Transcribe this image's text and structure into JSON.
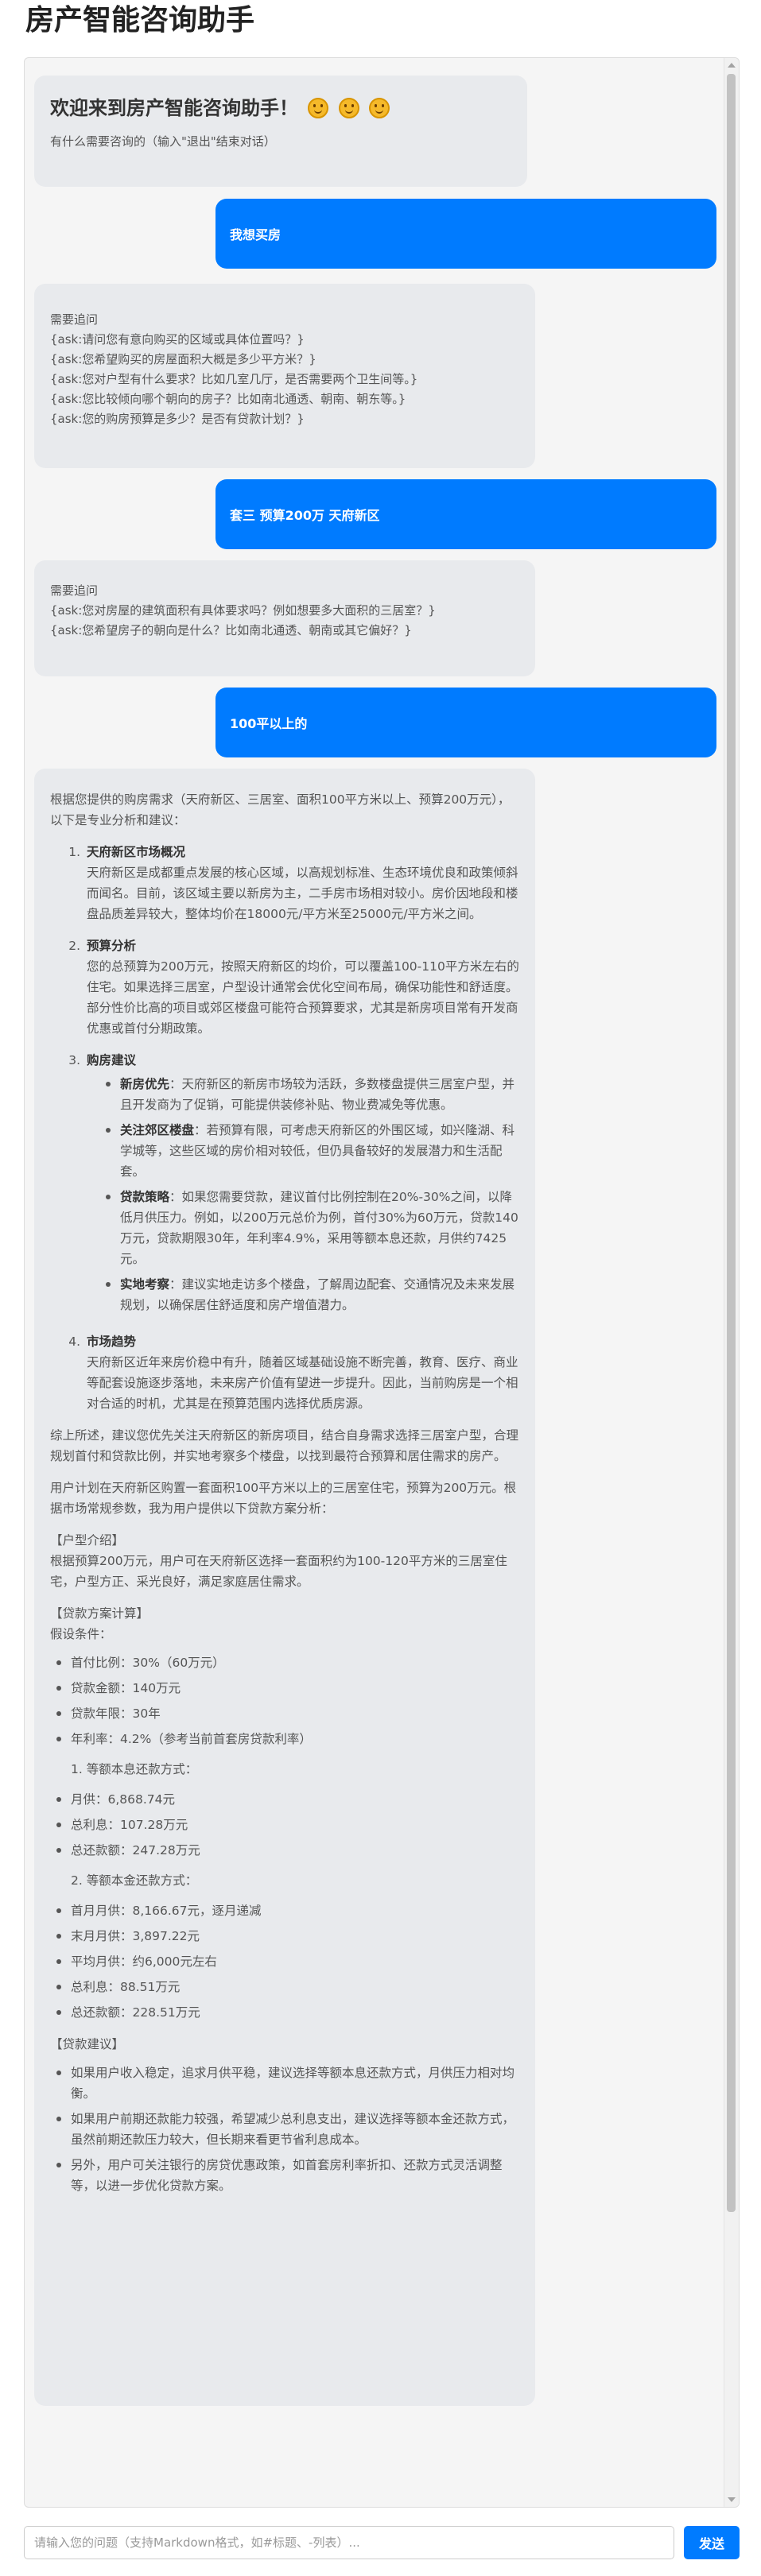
{
  "page": {
    "title": "房产智能咨询助手"
  },
  "welcome": {
    "title": "欢迎来到房产智能咨询助手！",
    "emoji_icons": [
      "smiling-face-icon",
      "smiling-face-icon",
      "smiling-face-icon"
    ],
    "subtitle": "有什么需要咨询的（输入\"退出\"结束对话）"
  },
  "messages": {
    "user1": "我想买房",
    "bot1": {
      "lines": [
        "需要追问",
        "{ask:请问您有意向购买的区域或具体位置吗？}",
        "{ask:您希望购买的房屋面积大概是多少平方米？}",
        "{ask:您对户型有什么要求？比如几室几厅，是否需要两个卫生间等。}",
        "{ask:您比较倾向哪个朝向的房子？比如南北通透、朝南、朝东等。}",
        "{ask:您的购房预算是多少？是否有贷款计划？}"
      ]
    },
    "user2": "套三 预算200万 天府新区",
    "bot2": {
      "lines": [
        "需要追问",
        "{ask:您对房屋的建筑面积有具体要求吗？例如想要多大面积的三居室？}",
        "{ask:您希望房子的朝向是什么？比如南北通透、朝南或其它偏好？}"
      ]
    },
    "user3": "100平以上的",
    "bot3": {
      "intro": "根据您提供的购房需求（天府新区、三居室、面积100平方米以上、预算200万元），以下是专业分析和建议：",
      "sections": [
        {
          "num": "1.",
          "head": "天府新区市场概况",
          "text": "天府新区是成都重点发展的核心区域，以高规划标准、生态环境优良和政策倾斜而闻名。目前，该区域主要以新房为主，二手房市场相对较小。房价因地段和楼盘品质差异较大，整体均价在18000元/平方米至25000元/平方米之间。"
        },
        {
          "num": "2.",
          "head": "预算分析",
          "text": "您的总预算为200万元，按照天府新区的均价，可以覆盖100-110平方米左右的住宅。如果选择三居室，户型设计通常会优化空间布局，确保功能性和舒适度。部分性价比高的项目或郊区楼盘可能符合预算要求，尤其是新房项目常有开发商优惠或首付分期政策。"
        },
        {
          "num": "3.",
          "head": "购房建议",
          "text": ""
        },
        {
          "num": "4.",
          "head": "市场趋势",
          "text": "天府新区近年来房价稳中有升，随着区域基础设施不断完善，教育、医疗、商业等配套设施逐步落地，未来房产价值有望进一步提升。因此，当前购房是一个相对合适的时机，尤其是在预算范围内选择优质房源。"
        }
      ],
      "advice": [
        {
          "head": "新房优先",
          "text": "：天府新区的新房市场较为活跃，多数楼盘提供三居室户型，并且开发商为了促销，可能提供装修补贴、物业费减免等优惠。"
        },
        {
          "head": "关注郊区楼盘",
          "text": "：若预算有限，可考虑天府新区的外围区域，如兴隆湖、科学城等，这些区域的房价相对较低，但仍具备较好的发展潜力和生活配套。"
        },
        {
          "head": "贷款策略",
          "text": "：如果您需要贷款，建议首付比例控制在20%-30%之间，以降低月供压力。例如，以200万元总价为例，首付30%为60万元，贷款140万元，贷款期限30年，年利率4.9%，采用等额本息还款，月供约7425元。"
        },
        {
          "head": "实地考察",
          "text": "：建议实地走访多个楼盘，了解周边配套、交通情况及未来发展规划，以确保居住舒适度和房产增值潜力。"
        }
      ],
      "summary": "综上所述，建议您优先关注天府新区的新房项目，结合自身需求选择三居室户型，合理规划首付和贷款比例，并实地考察多个楼盘，以找到最符合预算和居住需求的房产。",
      "plan_intro": "用户计划在天府新区购置一套面积100平方米以上的三居室住宅，预算为200万元。根据市场常规参数，我为用户提供以下贷款方案分析：",
      "unit_head": "【户型介绍】",
      "unit_text": "根据预算200万元，用户可在天府新区选择一套面积约为100-120平方米的三居室住宅，户型方正、采光良好，满足家庭居住需求。",
      "loan_head": "【贷款方案计算】",
      "assume": "假设条件：",
      "assumptions": [
        "首付比例：30%（60万元）",
        "贷款金额：140万元",
        "贷款年限：30年",
        "年利率：4.2%（参考当前首套房贷款利率）"
      ],
      "method1": "1. 等额本息还款方式：",
      "method1_items": [
        "月供：6,868.74元",
        "总利息：107.28万元",
        "总还款额：247.28万元"
      ],
      "method2": "2. 等额本金还款方式：",
      "method2_items": [
        "首月月供：8,166.67元，逐月递减",
        "末月月供：3,897.22元",
        "平均月供：约6,000元左右",
        "总利息：88.51万元",
        "总还款额：228.51万元"
      ],
      "suggest_head": "【贷款建议】",
      "suggestions": [
        "如果用户收入稳定，追求月供平稳，建议选择等额本息还款方式，月供压力相对均衡。",
        "如果用户前期还款能力较强，希望减少总利息支出，建议选择等额本金还款方式，虽然前期还款压力较大，但长期来看更节省利息成本。",
        "另外，用户可关注银行的房贷优惠政策，如首套房利率折扣、还款方式灵活调整等，以进一步优化贷款方案。"
      ]
    }
  },
  "input": {
    "placeholder": "请输入您的问题（支持Markdown格式，如#标题、-列表）..."
  },
  "send": {
    "label": "发送"
  },
  "colors": {
    "accent": "#007bff",
    "bot_bubble": "#e8eaed",
    "chat_bg": "#f5f5f5"
  }
}
